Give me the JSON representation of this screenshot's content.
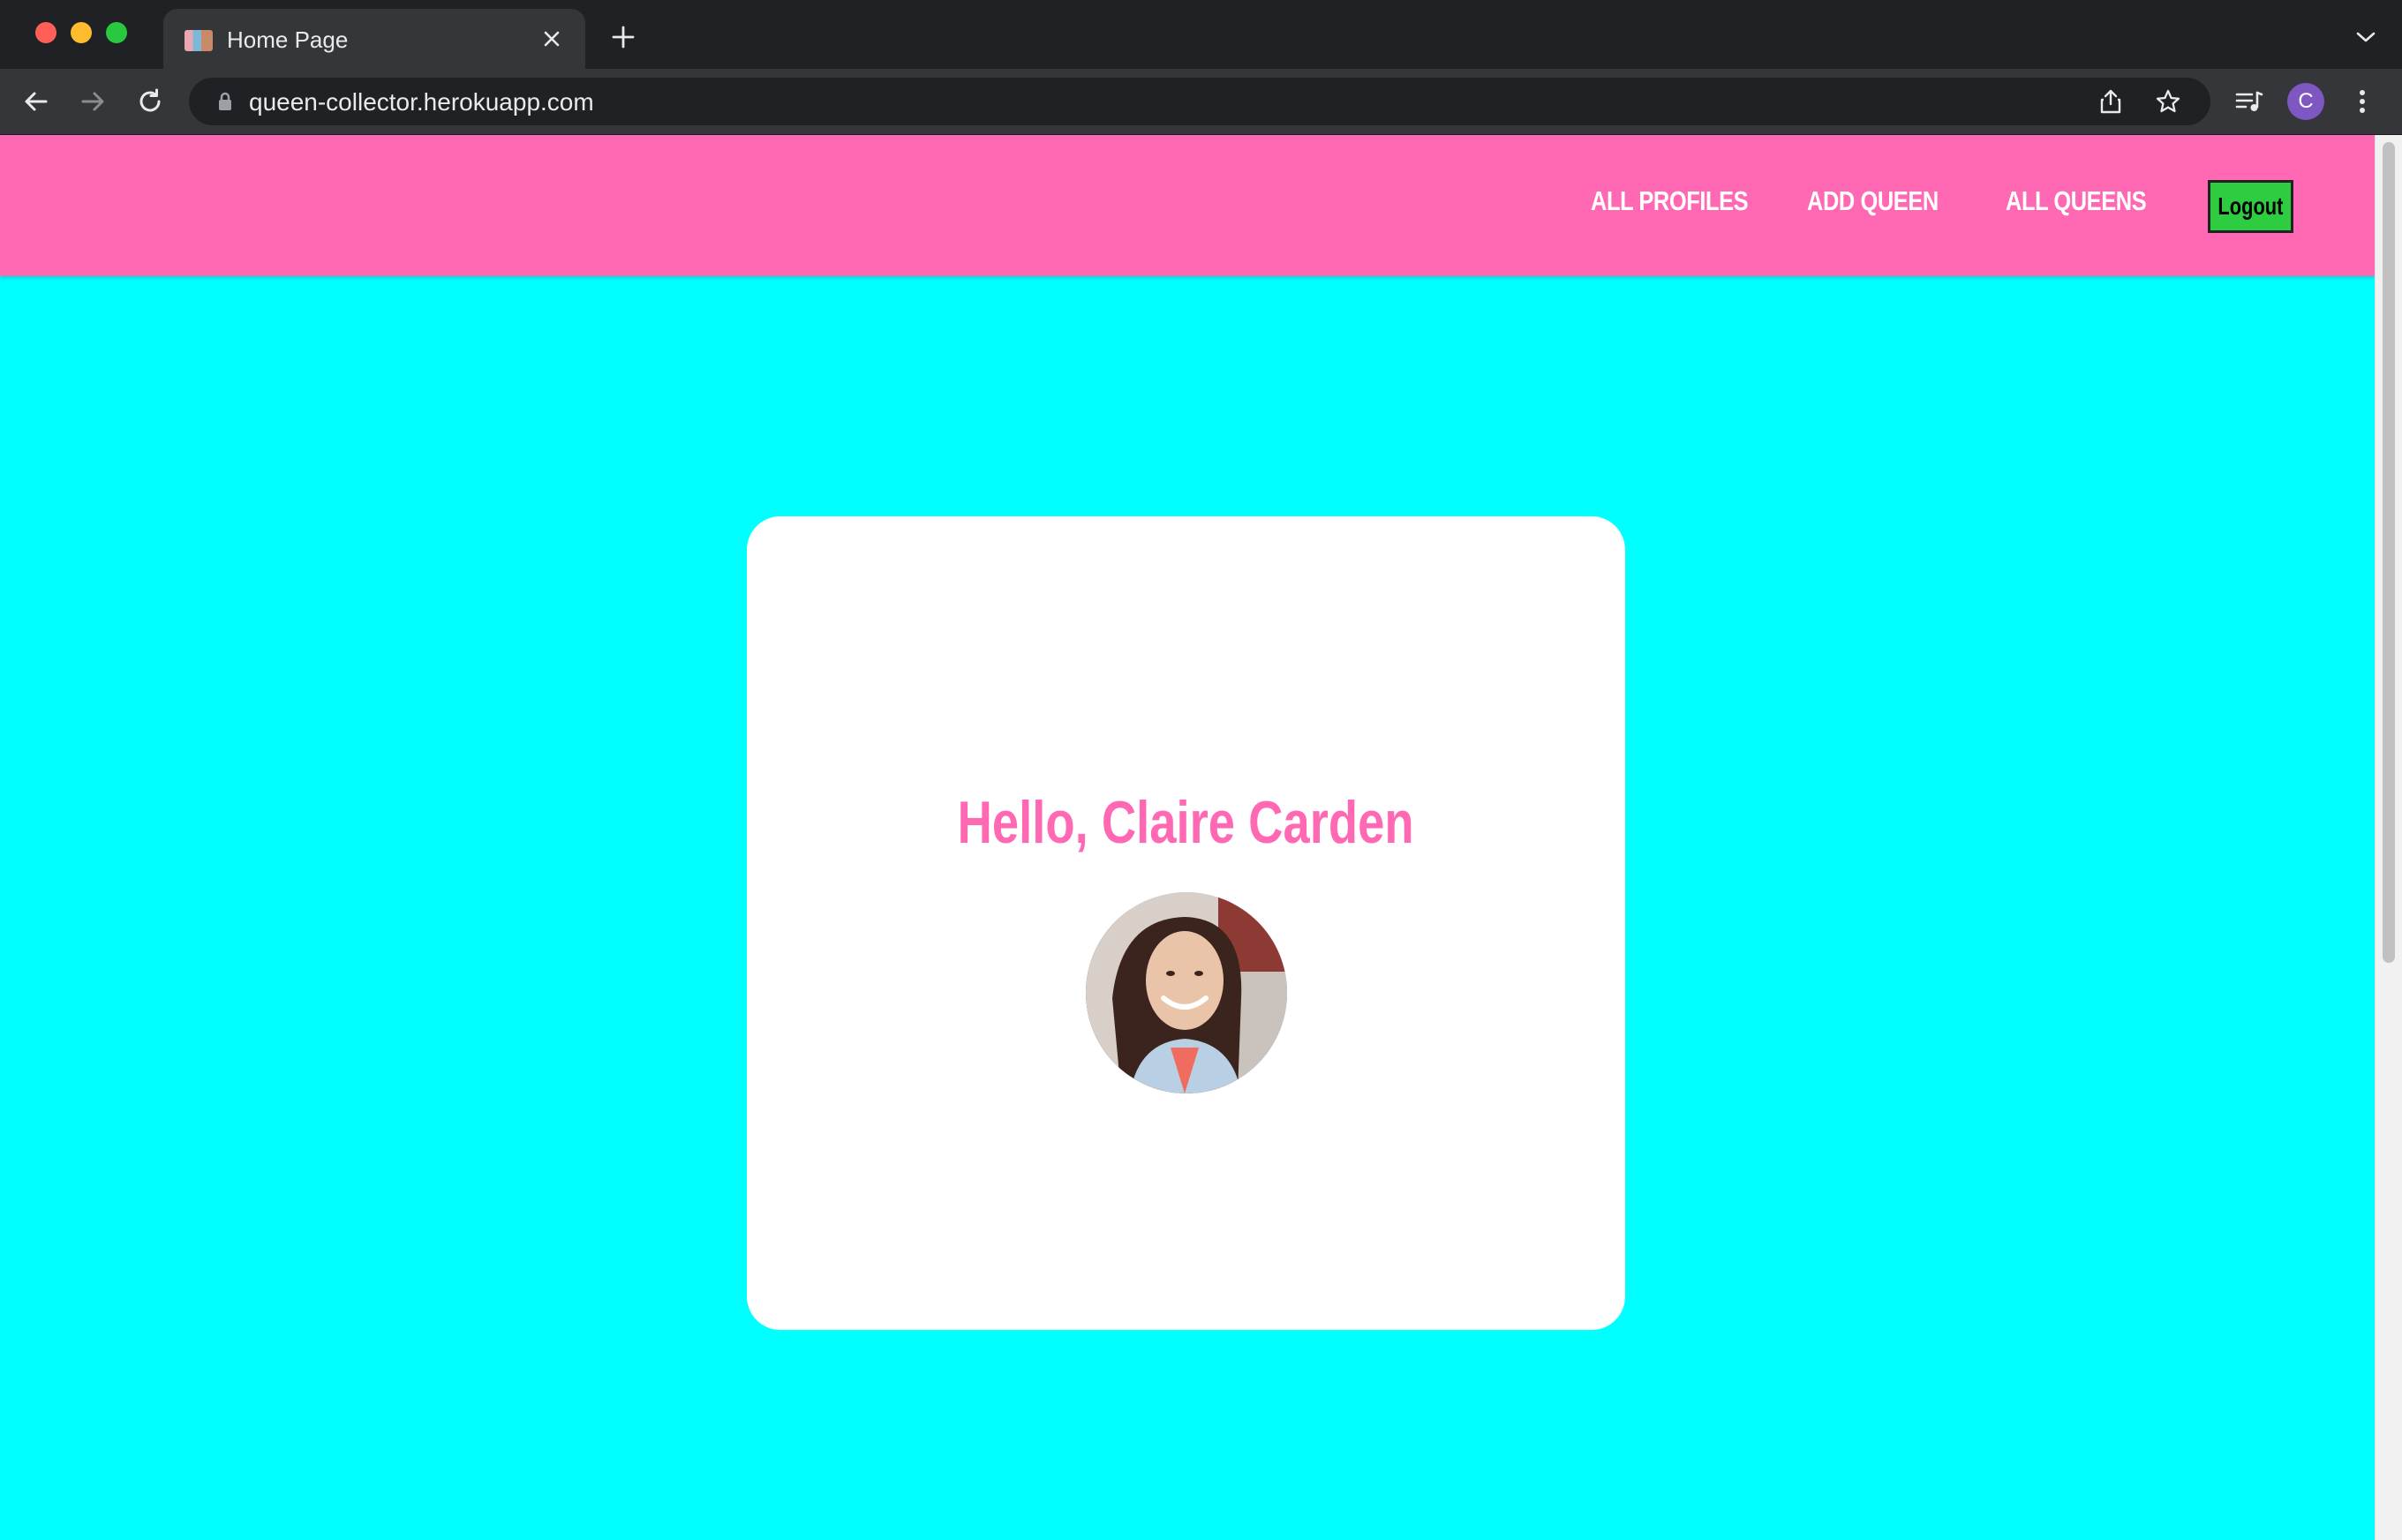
{
  "browser": {
    "tab_title": "Home Page",
    "url": "queen-collector.herokuapp.com",
    "profile_initial": "C"
  },
  "nav": {
    "links": [
      {
        "label": "ALL PROFILES"
      },
      {
        "label": "ADD QUEEN"
      },
      {
        "label": "ALL QUEENS"
      }
    ],
    "logout_label": "Logout"
  },
  "card": {
    "greeting": "Hello, Claire Carden"
  },
  "colors": {
    "navbar": "#ff69b4",
    "page_background": "#00ffff",
    "greeting_text": "#ff69b4",
    "logout_button": "#2ecc40"
  },
  "icons": {
    "tab_favicon": "tab-favicon-icon",
    "close": "close-icon",
    "new_tab": "plus-icon",
    "back": "arrow-left-icon",
    "forward": "arrow-right-icon",
    "reload": "reload-icon",
    "lock": "lock-icon",
    "share": "share-icon",
    "bookmark": "star-icon",
    "media": "media-queue-icon",
    "menu": "kebab-menu-icon",
    "tab_search": "chevron-down-icon"
  }
}
